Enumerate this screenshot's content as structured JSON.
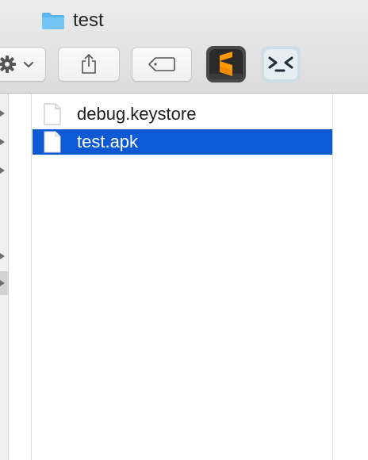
{
  "window": {
    "title": "test"
  },
  "toolbar": {
    "action_icon": "gear-icon",
    "share_icon": "share-icon",
    "tag_icon": "tag-icon",
    "apps": [
      {
        "name": "sublime-text-icon",
        "glyph": "S",
        "accent": "#ff9800"
      },
      {
        "name": "termius-icon",
        "glyph": ">_<"
      }
    ]
  },
  "files": [
    {
      "name": "debug.keystore",
      "selected": false
    },
    {
      "name": "test.apk",
      "selected": true
    }
  ],
  "colors": {
    "selection": "#0e5ad5",
    "folder": "#5ab6f0"
  }
}
